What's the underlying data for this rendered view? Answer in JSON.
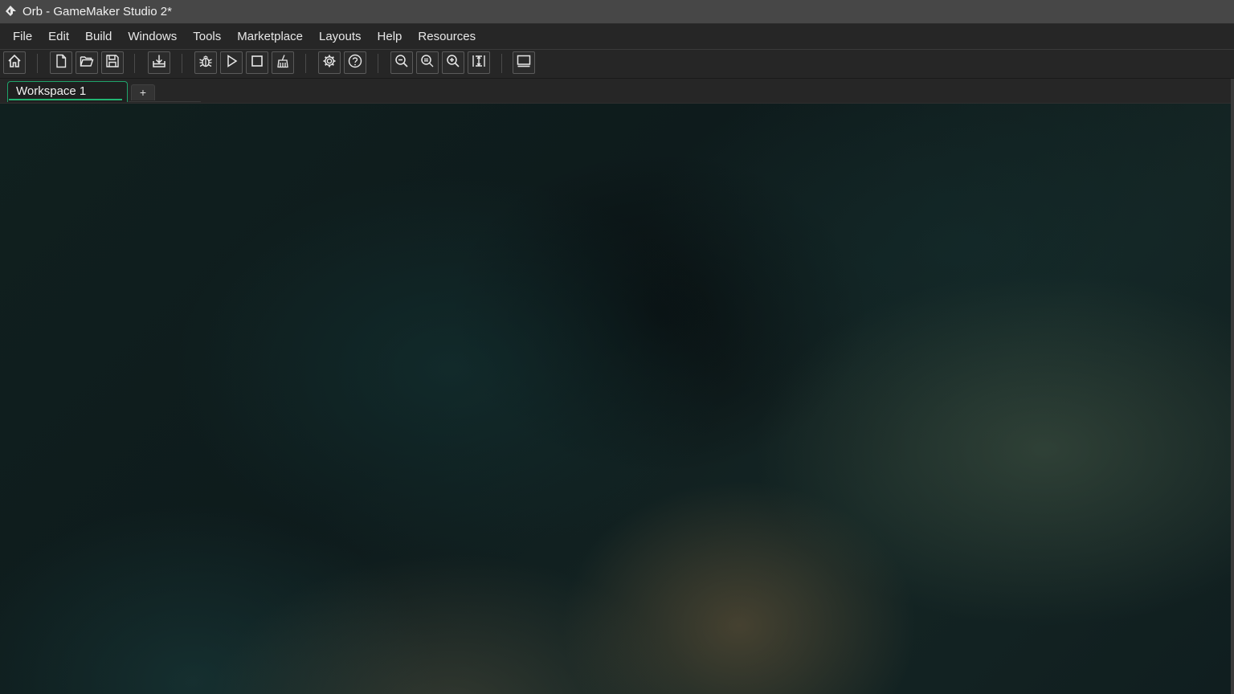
{
  "window": {
    "title": "Orb - GameMaker Studio 2*",
    "app_icon": "gamemaker-logo-icon"
  },
  "menubar": {
    "items": [
      {
        "label": "File"
      },
      {
        "label": "Edit"
      },
      {
        "label": "Build"
      },
      {
        "label": "Windows"
      },
      {
        "label": "Tools"
      },
      {
        "label": "Marketplace"
      },
      {
        "label": "Layouts"
      },
      {
        "label": "Help"
      },
      {
        "label": "Resources"
      }
    ]
  },
  "toolbar": {
    "buttons": [
      {
        "icon": "home-icon"
      },
      {
        "icon": "new-project-icon"
      },
      {
        "icon": "open-project-icon"
      },
      {
        "icon": "save-icon"
      },
      {
        "icon": "create-executable-icon"
      },
      {
        "icon": "debug-icon"
      },
      {
        "icon": "run-icon"
      },
      {
        "icon": "stop-icon"
      },
      {
        "icon": "clean-icon"
      },
      {
        "icon": "game-options-icon"
      },
      {
        "icon": "help-icon"
      },
      {
        "icon": "zoom-out-icon"
      },
      {
        "icon": "zoom-reset-icon"
      },
      {
        "icon": "zoom-in-icon"
      },
      {
        "icon": "fit-to-window-icon"
      },
      {
        "icon": "target-device-icon"
      }
    ]
  },
  "workspace_tabs": {
    "tabs": [
      {
        "label": "Workspace 1",
        "active": true
      }
    ],
    "add_label": "+"
  },
  "colors": {
    "accent": "#22b573",
    "titlebar": "#474747",
    "menubar": "#262626"
  }
}
